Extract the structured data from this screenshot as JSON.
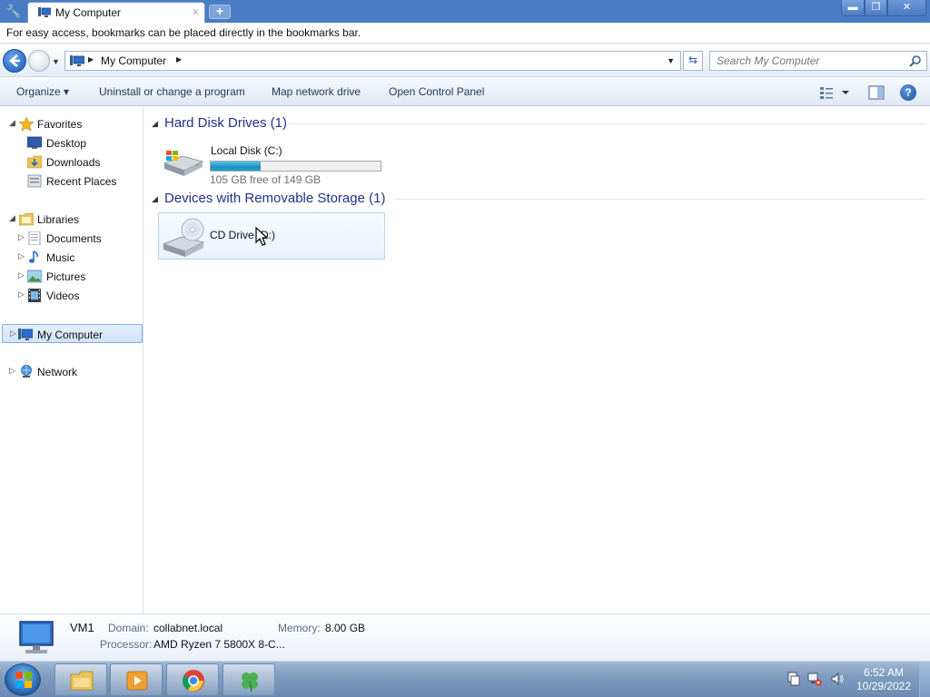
{
  "browser": {
    "tab_title": "My Computer",
    "tab_close_glyph": "×",
    "new_tab_glyph": "+",
    "wrench_glyph": "🔧",
    "bookmark_hint": "For easy access, bookmarks can be placed directly in the bookmarks bar.",
    "window_controls": {
      "minimize": "▬",
      "maximize": "❐",
      "close": "✕"
    }
  },
  "address": {
    "breadcrumb": "My Computer",
    "search_placeholder": "Search My Computer"
  },
  "toolbar": {
    "organize": "Organize ▾",
    "uninstall": "Uninstall or change a program",
    "map_drive": "Map network drive",
    "control_panel": "Open Control Panel",
    "help_glyph": "?"
  },
  "nav": {
    "favorites": "Favorites",
    "desktop": "Desktop",
    "downloads": "Downloads",
    "recent_places": "Recent Places",
    "libraries": "Libraries",
    "documents": "Documents",
    "music": "Music",
    "pictures": "Pictures",
    "videos": "Videos",
    "my_computer": "My Computer",
    "network": "Network"
  },
  "content": {
    "hard_disk_header": "Hard Disk Drives (1)",
    "local_disk_name": "Local Disk (C:)",
    "local_disk_free": "105 GB free of 149 GB",
    "local_disk_used_fraction": 0.295,
    "removable_header": "Devices with Removable Storage (1)",
    "cd_drive_name": "CD Drive (D:)"
  },
  "details": {
    "computer_name": "VM1",
    "domain_label": "Domain:",
    "domain_value": "collabnet.local",
    "memory_label": "Memory:",
    "memory_value": "8.00 GB",
    "processor_label": "Processor:",
    "processor_value": "AMD Ryzen 7 5800X 8-C..."
  },
  "taskbar": {
    "time": "6:52 AM",
    "date": "10/29/2022"
  },
  "colors": {
    "titlebar": "#4a7cc5",
    "disk_bar_fill": "#1c8fbf",
    "group_header": "#1e3287"
  }
}
